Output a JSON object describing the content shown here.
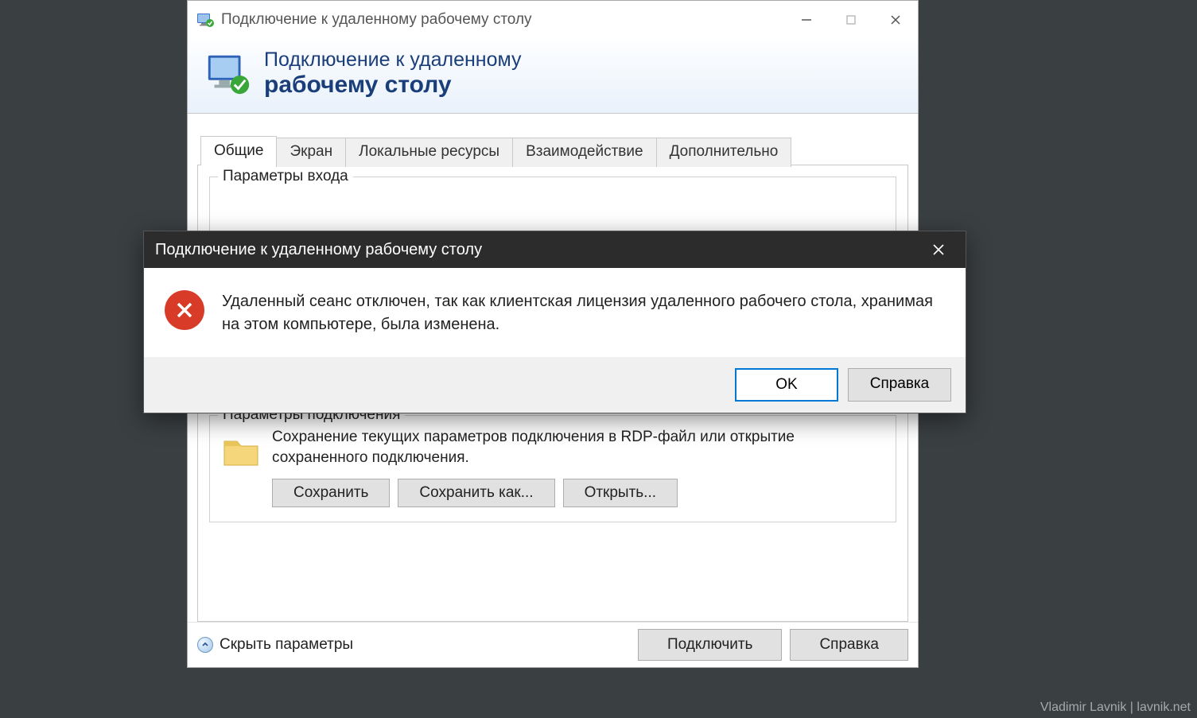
{
  "main_window": {
    "title": "Подключение к удаленному рабочему столу",
    "banner_line1": "Подключение к удаленному",
    "banner_line2": "рабочему столу",
    "tabs": {
      "general": "Общие",
      "screen": "Экран",
      "local_resources": "Локальные ресурсы",
      "interaction": "Взаимодействие",
      "advanced": "Дополнительно"
    },
    "login_group": "Параметры входа",
    "conn_group": {
      "legend": "Параметры подключения",
      "desc": "Сохранение текущих параметров подключения в RDP-файл или открытие сохраненного подключения.",
      "save": "Сохранить",
      "save_as": "Сохранить как...",
      "open": "Открыть..."
    },
    "hide_params": "Скрыть параметры",
    "connect": "Подключить",
    "help": "Справка"
  },
  "modal": {
    "title": "Подключение к удаленному рабочему столу",
    "message": "Удаленный сеанс отключен, так как клиентская лицензия удаленного рабочего стола, хранимая на этом компьютере, была изменена.",
    "ok": "OK",
    "help": "Справка"
  },
  "watermark": "Vladimir Lavnik | lavnik.net"
}
